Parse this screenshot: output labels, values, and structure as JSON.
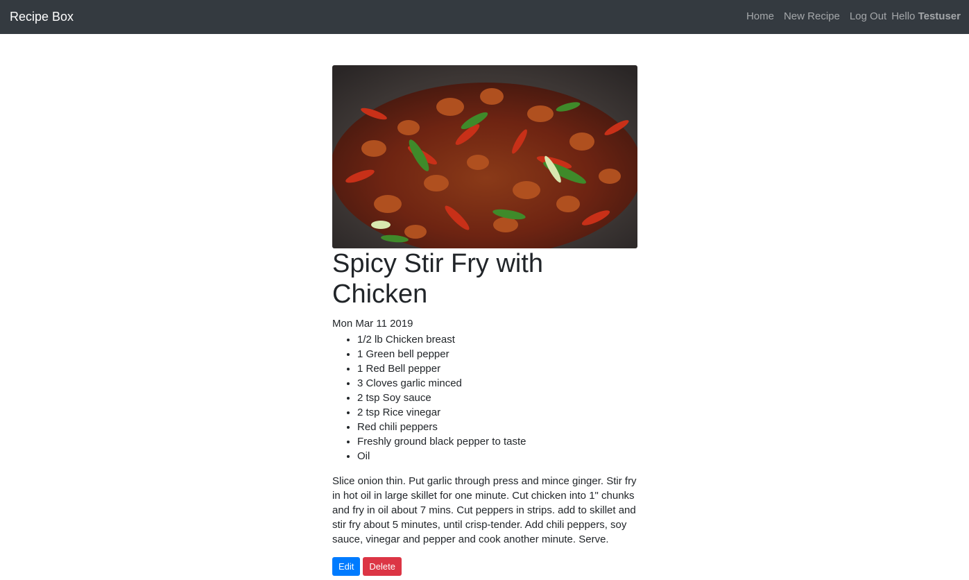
{
  "navbar": {
    "brand": "Recipe Box",
    "links": [
      "Home",
      "New Recipe",
      "Log Out"
    ],
    "greeting_prefix": "Hello",
    "username": "Testuser"
  },
  "recipe": {
    "title": "Spicy Stir Fry with Chicken",
    "date": "Mon Mar 11 2019",
    "ingredients": [
      "1/2 lb Chicken breast",
      "1 Green bell pepper",
      "1 Red Bell pepper",
      "3 Cloves garlic minced",
      "2 tsp Soy sauce",
      "2 tsp Rice vinegar",
      "Red chili peppers",
      "Freshly ground black pepper to taste",
      "Oil"
    ],
    "directions": "Slice onion thin. Put garlic through press and mince ginger. Stir fry in hot oil in large skillet for one minute. Cut chicken into 1\" chunks and fry in oil about 7 mins. Cut peppers in strips. add to skillet and stir fry about 5 minutes, until crisp-tender. Add chili peppers, soy sauce, vinegar and pepper and cook another minute. Serve.",
    "edit_label": "Edit",
    "delete_label": "Delete"
  }
}
